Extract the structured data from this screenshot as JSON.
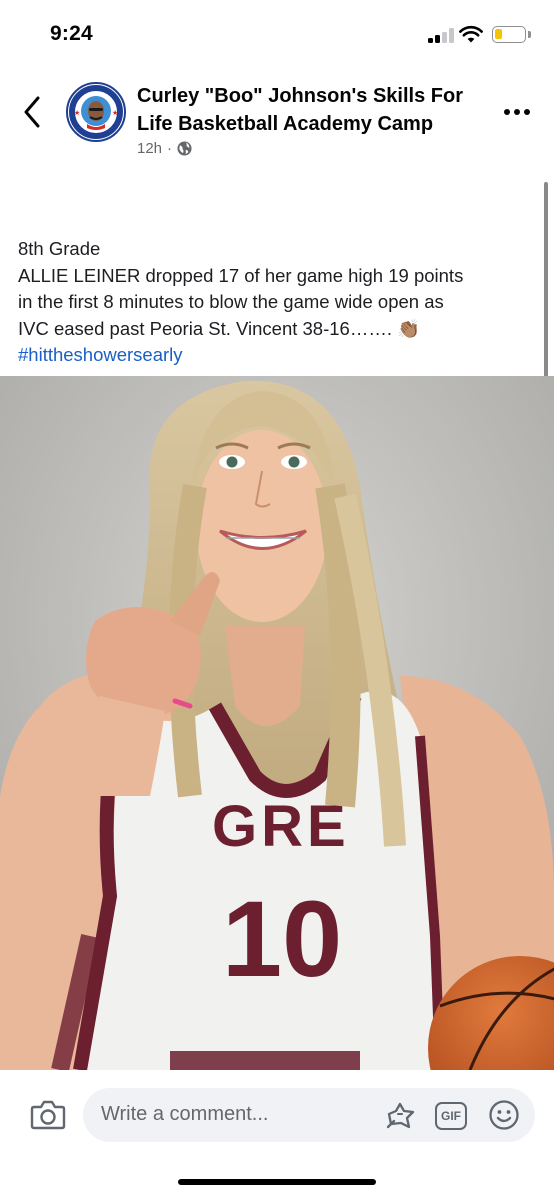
{
  "status_bar": {
    "time": "9:24"
  },
  "post": {
    "page_name": "Curley \"Boo\" Johnson's Skills For Life Basketball Academy Camp",
    "age": "12h",
    "separator": "·",
    "visibility_icon": "globe-icon",
    "caption_lines": [
      "8th Grade",
      "ALLIE LEINER dropped 17 of her game high 19 points",
      "in the first 8 minutes to blow the game wide open as",
      "IVC eased past Peoria St. Vincent 38-16……. 👏🏽"
    ],
    "hashtag": "#hittheshowersearly",
    "photo": {
      "jersey_text": "GRE",
      "jersey_number": "10"
    }
  },
  "comment_bar": {
    "placeholder": "Write a comment...",
    "gif_label": "GIF"
  },
  "colors": {
    "link": "#1b5fc4",
    "secondary_text": "#65676b",
    "input_bg": "#f0f2f5",
    "jersey_maroon": "#6b1f2f",
    "battery_low": "#f5c400"
  }
}
